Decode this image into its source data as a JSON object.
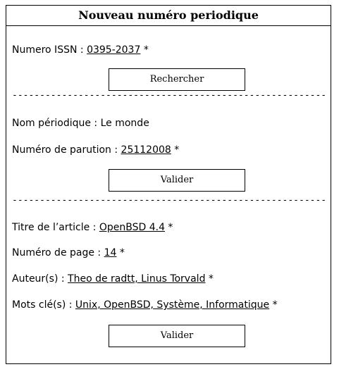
{
  "title": "Nouveau numéro periodique",
  "issn": {
    "label": "Numero ISSN : ",
    "value": "0395-2037",
    "required": " *",
    "search_button": "Rechercher"
  },
  "separator": "----------------------------------------------------------",
  "periodique": {
    "nom_label": "Nom périodique : ",
    "nom_value": " Le monde",
    "parution_label": "Numéro de parution : ",
    "parution_value": "25112008",
    "parution_required": " *",
    "validate_button": "Valider"
  },
  "article": {
    "titre_label": "Titre de l’article : ",
    "titre_value": "OpenBSD 4.4",
    "titre_required": " *",
    "page_label": "Numéro de page : ",
    "page_value": "14",
    "page_required": " *",
    "auteurs_label": "Auteur(s) : ",
    "auteurs_value": "Theo de radtt, Linus Torvald",
    "auteurs_required": " *",
    "mots_label": "Mots clé(s) : ",
    "mots_value": "Unix, OpenBSD, Système, Informatique",
    "mots_required": " *",
    "validate_button": "Valider"
  }
}
